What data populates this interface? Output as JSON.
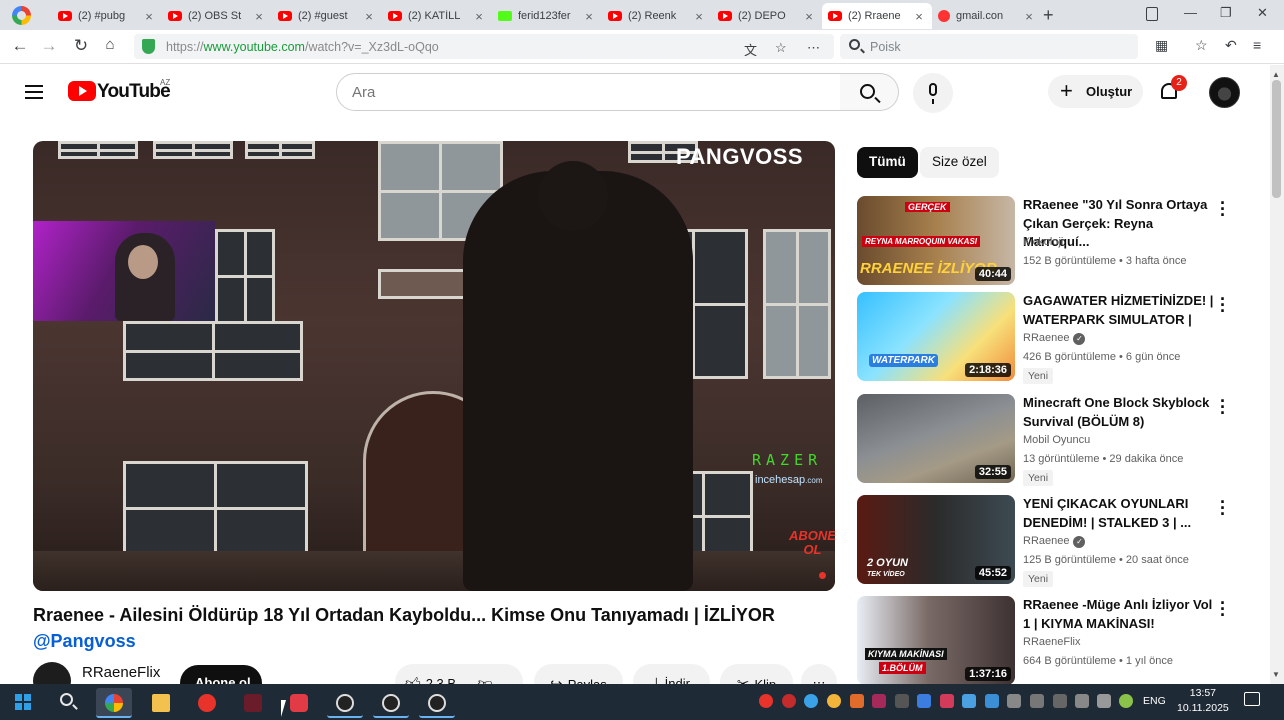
{
  "browser": {
    "tabs": [
      {
        "title": "(2) #pubg",
        "favicon": "youtube-icon"
      },
      {
        "title": "(2) OBS St",
        "favicon": "youtube-icon"
      },
      {
        "title": "(2) #guest",
        "favicon": "youtube-icon"
      },
      {
        "title": "(2) KATİLL",
        "favicon": "youtube-icon"
      },
      {
        "title": "ferid123fer",
        "favicon": "kick-icon"
      },
      {
        "title": "(2) Reenk",
        "favicon": "youtube-icon"
      },
      {
        "title": "(2) DEPO",
        "favicon": "youtube-icon"
      },
      {
        "title": "(2) Rraene",
        "favicon": "youtube-icon",
        "active": true
      },
      {
        "title": "gmail.con",
        "favicon": "yandex-icon"
      }
    ],
    "close_glyph": "×",
    "new_tab_glyph": "+",
    "url_prefix": "https://",
    "url_host": "www.youtube.com",
    "url_path": "/watch?v=_Xz3dL-oQqo",
    "search_placeholder": "Poisk",
    "window_controls": {
      "minimize": "—",
      "restore": "❐",
      "close": "✕"
    }
  },
  "youtube": {
    "logo_text": "YouTube",
    "country_code": "AZ",
    "search_placeholder": "Ara",
    "create_label": "Oluştur",
    "notification_count": "2"
  },
  "video": {
    "watermark": "PANGVOSS",
    "sponsor": "RAZER",
    "sponsor_site": "incehesap",
    "sponsor_site_tld": ".com",
    "abone_line1": "ABONE",
    "abone_line2": "OL",
    "title": "Rraenee - Ailesini Öldürüp 18 Yıl Ortadan Kayboldu... Kimse Onu Tanıyamadı | İZLİYOR",
    "handle": "@Pangvoss",
    "channel_name": "RRaeneFlix",
    "subscribe_label": "Abone ol",
    "likes": "2,3 B",
    "share_label": "Paylaş",
    "download_label": "İndir",
    "clip_label": "Klip"
  },
  "chips": [
    {
      "label": "Tümü",
      "selected": true
    },
    {
      "label": "Size özel",
      "selected": false
    }
  ],
  "recommendations": [
    {
      "title": "RRaenee \"30 Yıl Sonra Ortaya Çıkan Gerçek: Reyna Marroquí...",
      "channel": "Kickoloji",
      "verified": false,
      "meta": "152 B görüntüleme • 3 hafta önce",
      "duration": "40:44",
      "badge": "",
      "thumb_text_top": "GERÇEK",
      "thumb_text_mid": "REYNA MARROQUIN VAKASI",
      "thumb_text_bottom": "RRAENEE İZLİYOR"
    },
    {
      "title": "GAGAWATER HİZMETİNİZDE! | WATERPARK SIMULATOR |",
      "channel": "RRaenee",
      "verified": true,
      "meta": "426 B görüntüleme • 6 gün önce",
      "duration": "2:18:36",
      "badge": "Yeni",
      "thumb_text_top": "WATERPARK"
    },
    {
      "title": "Minecraft One Block Skyblock Survival (BÖLÜM 8)",
      "channel": "Mobil Oyuncu",
      "verified": false,
      "meta": "13 görüntüleme • 29 dakika önce",
      "duration": "32:55",
      "badge": "Yeni"
    },
    {
      "title": "YENİ ÇIKACAK OYUNLARI DENEDİM! | STALKED 3 | ...",
      "channel": "RRaenee",
      "verified": true,
      "meta": "125 B görüntüleme • 20 saat önce",
      "duration": "45:52",
      "badge": "Yeni",
      "thumb_text_top": "2 OYUN",
      "thumb_text_bottom": "TEK VİDEO"
    },
    {
      "title": "RRaenee -Müge Anlı İzliyor Vol 1 | KIYMA MAKİNASI!",
      "channel": "RRaeneFlix",
      "verified": false,
      "meta": "664 B görüntüleme • 1 yıl önce",
      "duration": "1:37:16",
      "badge": "",
      "thumb_text_top": "KIYMA MAKİNASI",
      "thumb_text_bottom": "1.BÖLÜM"
    }
  ],
  "taskbar": {
    "language": "ENG",
    "time": "13:57",
    "date": "10.11.2025"
  },
  "colors": {
    "youtube_red": "#ff0000",
    "link_blue": "#065fd4",
    "taskbar": "#1f2a37",
    "razer_green": "#44d62c"
  }
}
